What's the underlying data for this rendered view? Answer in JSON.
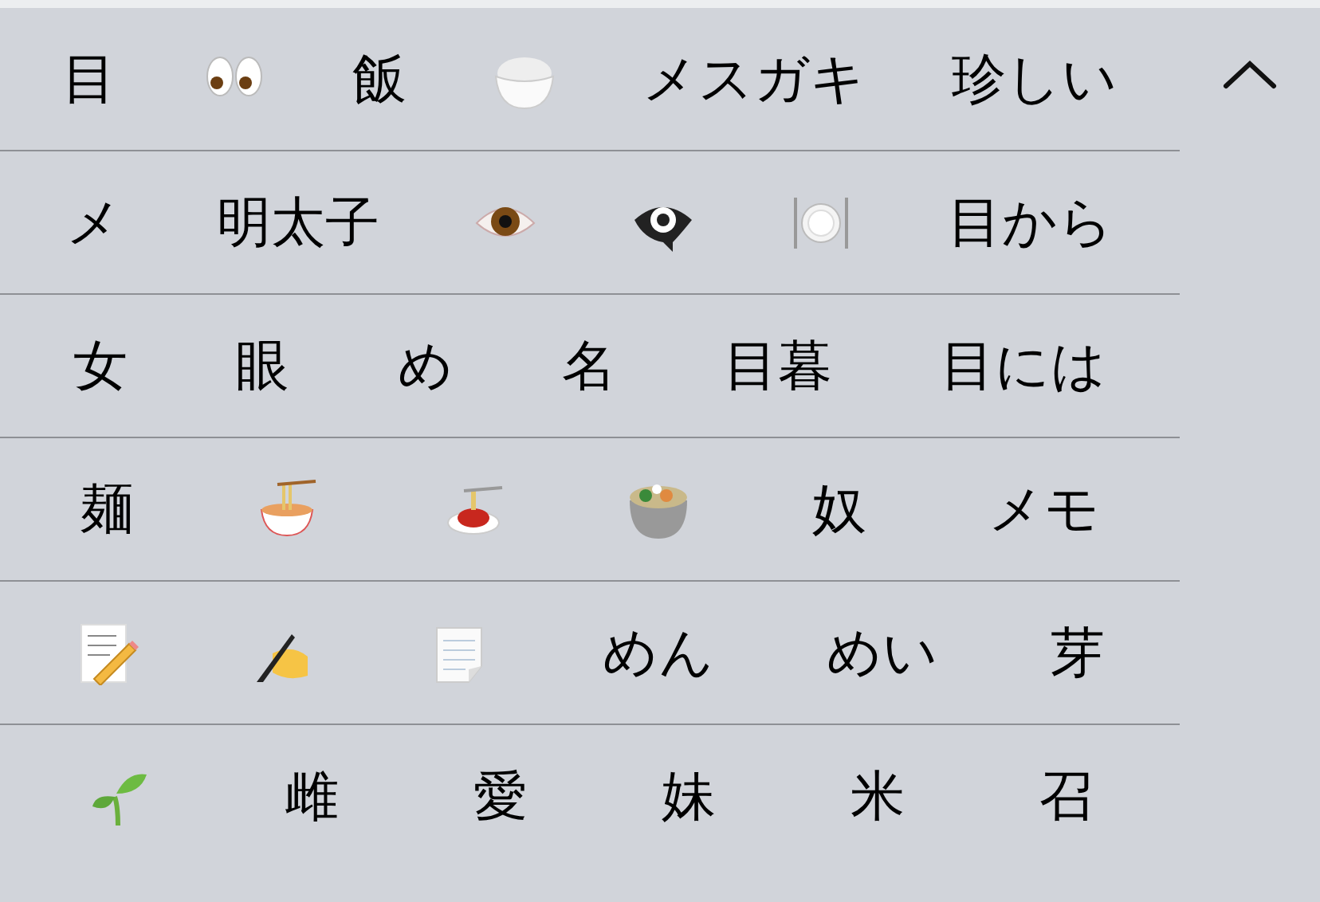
{
  "candidate_rows": [
    {
      "candidates": [
        {
          "kind": "text",
          "text": "目"
        },
        {
          "kind": "eyes"
        },
        {
          "kind": "text",
          "text": "飯"
        },
        {
          "kind": "rice"
        },
        {
          "kind": "text",
          "text": "メスガキ"
        },
        {
          "kind": "text",
          "text": "珍しい"
        }
      ]
    },
    {
      "candidates": [
        {
          "kind": "text",
          "text": "メ"
        },
        {
          "kind": "text",
          "text": "明太子"
        },
        {
          "kind": "eye"
        },
        {
          "kind": "eyebubble"
        },
        {
          "kind": "plate"
        },
        {
          "kind": "text",
          "text": "目から"
        }
      ]
    },
    {
      "candidates": [
        {
          "kind": "text",
          "text": "女"
        },
        {
          "kind": "text",
          "text": "眼"
        },
        {
          "kind": "text",
          "text": "め"
        },
        {
          "kind": "text",
          "text": "名"
        },
        {
          "kind": "text",
          "text": "目暮"
        },
        {
          "kind": "text",
          "text": "目には"
        }
      ]
    },
    {
      "candidates": [
        {
          "kind": "text",
          "text": "麺"
        },
        {
          "kind": "ramen"
        },
        {
          "kind": "spaghetti"
        },
        {
          "kind": "stew"
        },
        {
          "kind": "text",
          "text": "奴"
        },
        {
          "kind": "text",
          "text": "メモ"
        }
      ]
    },
    {
      "candidates": [
        {
          "kind": "memo"
        },
        {
          "kind": "writing"
        },
        {
          "kind": "notepad"
        },
        {
          "kind": "text",
          "text": "めん"
        },
        {
          "kind": "text",
          "text": "めい"
        },
        {
          "kind": "text",
          "text": "芽"
        }
      ]
    },
    {
      "candidates": [
        {
          "kind": "seedling"
        },
        {
          "kind": "text",
          "text": "雌"
        },
        {
          "kind": "text",
          "text": "愛"
        },
        {
          "kind": "text",
          "text": "妹"
        },
        {
          "kind": "text",
          "text": "米"
        },
        {
          "kind": "text",
          "text": "召"
        }
      ]
    }
  ]
}
